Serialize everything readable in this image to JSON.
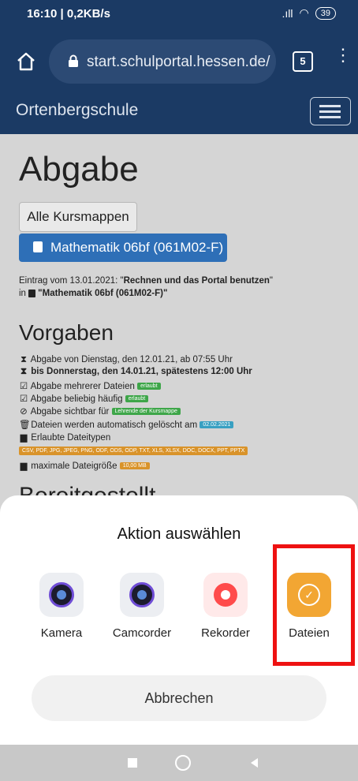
{
  "status_bar": {
    "time_speed": "16:10 | 0,2KB/s",
    "signal": ".ıll",
    "battery": "39"
  },
  "browser": {
    "url": "start.schulportal.hessen.de/",
    "tab_count": "5"
  },
  "site": {
    "brand": "Ortenbergschule"
  },
  "page": {
    "title": "Abgabe",
    "btn_all_folders": "Alle Kursmappen",
    "btn_course": "Mathematik 06bf (061M02-F)",
    "entry_line1_prefix": "Eintrag vom 13.01.2021: \"",
    "entry_line1_bold": "Rechnen und das Portal benutzen",
    "entry_line1_suffix": "\"",
    "entry_line2_prefix": "in ",
    "entry_line2_bold": "\"Mathematik 06bf (061M02-F)\"",
    "vorgaben_heading": "Vorgaben",
    "requirements": [
      {
        "text": "Abgabe von Dienstag, den 12.01.21, ab 07:55 Uhr"
      },
      {
        "text": "bis Donnerstag, den 14.01.21, spätestens 12:00 Uhr"
      },
      {
        "text": "Abgabe mehrerer Dateien",
        "tag": "erlaubt"
      },
      {
        "text": "Abgabe beliebig häufig",
        "tag": "erlaubt"
      },
      {
        "text": "Abgabe sichtbar für",
        "tag": "Lehrende der Kursmappe"
      },
      {
        "text": "Dateien werden automatisch gelöscht am",
        "tag": "02.02.2021"
      },
      {
        "text": "Erlaubte Dateitypen"
      },
      {
        "text": "maximale Dateigröße",
        "tag": "10,00 MB"
      }
    ],
    "filetypes": "CSV, PDF, JPG, JPEG, PNG, ODF, ODS, ODP, TXT, XLS, XLSX, DOC, DOCX, PPT, PPTX",
    "partial_heading": "Bereitgestellt"
  },
  "sheet": {
    "title": "Aktion auswählen",
    "apps": [
      {
        "label": "Kamera",
        "icon": "camera-icon"
      },
      {
        "label": "Camcorder",
        "icon": "camcorder-icon"
      },
      {
        "label": "Rekorder",
        "icon": "recorder-icon"
      },
      {
        "label": "Dateien",
        "icon": "files-icon"
      }
    ],
    "cancel": "Abbrechen"
  },
  "colors": {
    "brand": "#1b3a64",
    "primary_button": "#2e6fb7",
    "highlight": "#ee1111",
    "files_accent": "#f2a633"
  }
}
